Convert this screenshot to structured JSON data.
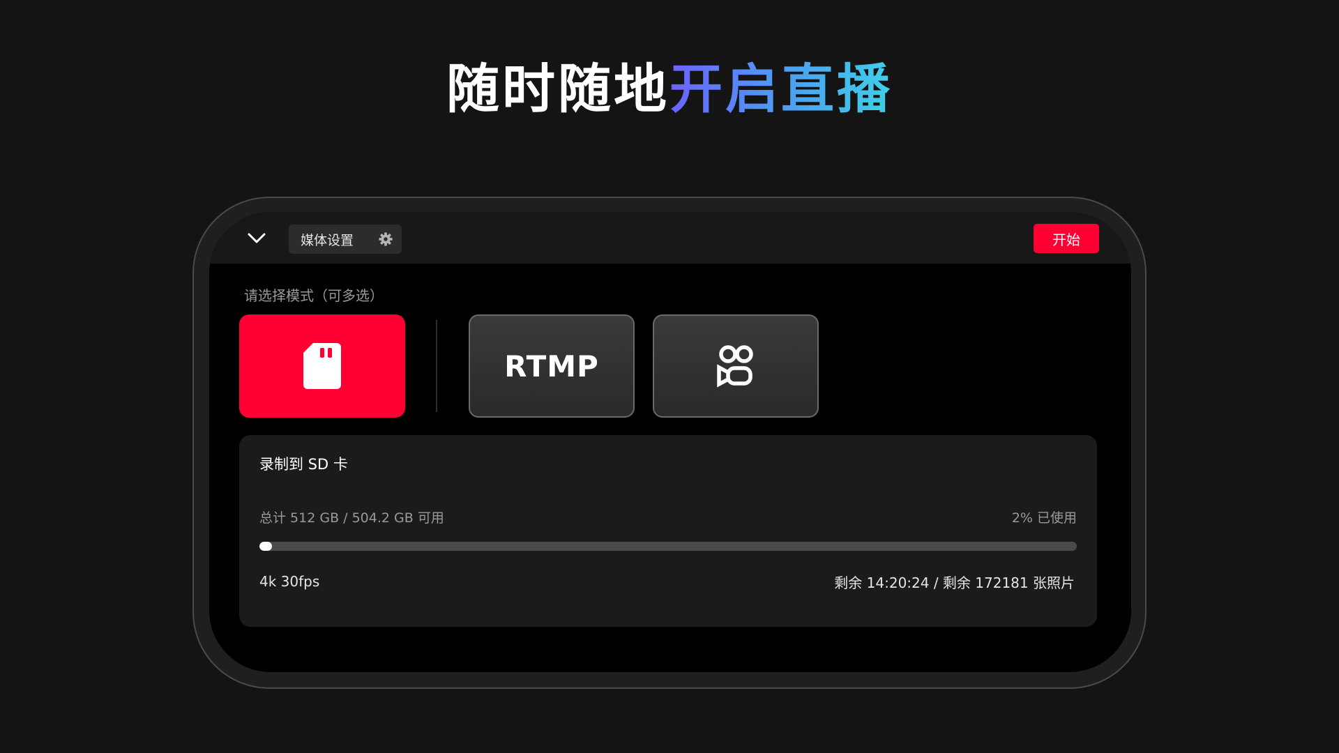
{
  "headline": {
    "plain": "随时随地",
    "accent": "开启直播"
  },
  "topbar": {
    "media_settings_label": "媒体设置",
    "start_label": "开始"
  },
  "modes": {
    "hint": "请选择模式（可多选）",
    "items": [
      {
        "name": "sd-card",
        "icon": "sd-card-icon",
        "selected": true
      },
      {
        "name": "rtmp",
        "label": "RTMP",
        "selected": false
      },
      {
        "name": "camera",
        "icon": "video-camera-icon",
        "selected": false
      }
    ]
  },
  "panel": {
    "title": "录制到 SD 卡",
    "storage_summary": "总计 512 GB / 504.2 GB 可用",
    "usage": "2% 已使用",
    "usage_fraction": 0.015,
    "format": "4k 30fps",
    "remaining": "剩余 14:20:24 / 剩余 172181 张照片"
  },
  "colors": {
    "accent_red": "#ff0033",
    "gradient_start": "#6b63ff",
    "gradient_end": "#3fd0e8"
  }
}
